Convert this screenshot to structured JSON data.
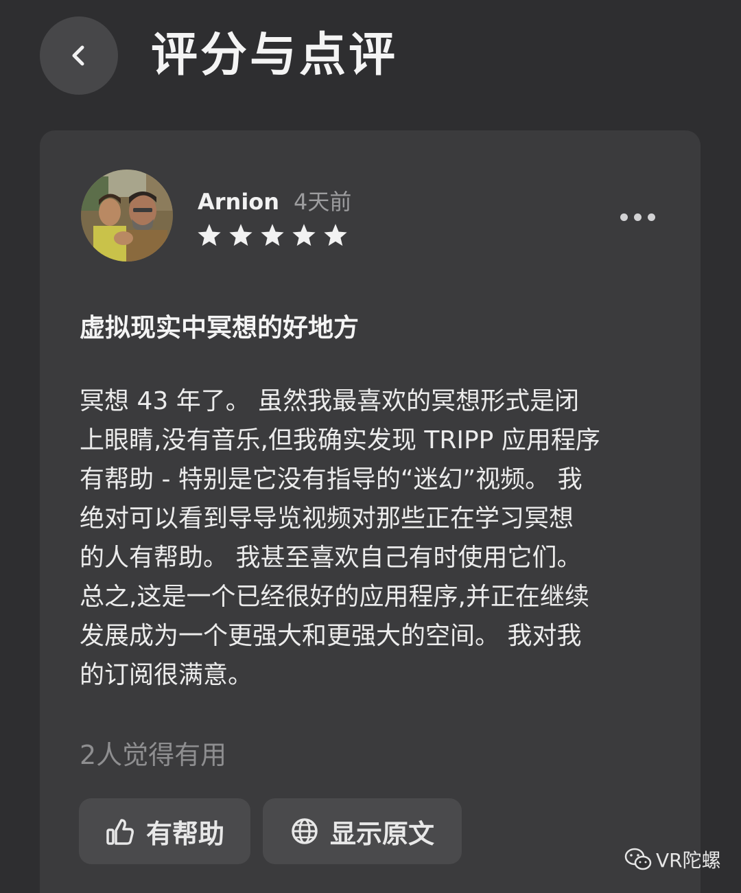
{
  "header": {
    "title": "评分与点评",
    "back_icon": "chevron-left-icon"
  },
  "review": {
    "reviewer": "Arnion",
    "time_ago": "4天前",
    "rating": 5,
    "rating_max": 5,
    "more_icon": "more-horizontal-icon",
    "title": "虚拟现实中冥想的好地方",
    "body_lines": [
      "冥想 43 年了。 虽然我最喜欢的冥想形式是闭",
      "上眼睛,没有音乐,但我确实发现 TRIPP 应用程序",
      "有帮助 - 特别是它没有指导的“迷幻”视频。 我",
      "绝对可以看到导导览视频对那些正在学习冥想",
      "的人有帮助。 我甚至喜欢自己有时使用它们。",
      "总之,这是一个已经很好的应用程序,并正在继续",
      "发展成为一个更强大和更强大的空间。 我对我",
      "的订阅很满意。"
    ],
    "helpful_count_text": "2人觉得有用"
  },
  "actions": {
    "helpful_label": "有帮助",
    "helpful_icon": "thumbs-up-icon",
    "original_label": "显示原文",
    "original_icon": "globe-icon"
  },
  "watermark": {
    "text": "VR陀螺",
    "icon": "wechat-icon"
  },
  "colors": {
    "background": "#2e2e30",
    "card": "#3b3b3d",
    "button": "#4a4a4c",
    "muted_text": "#9d9d9f"
  }
}
